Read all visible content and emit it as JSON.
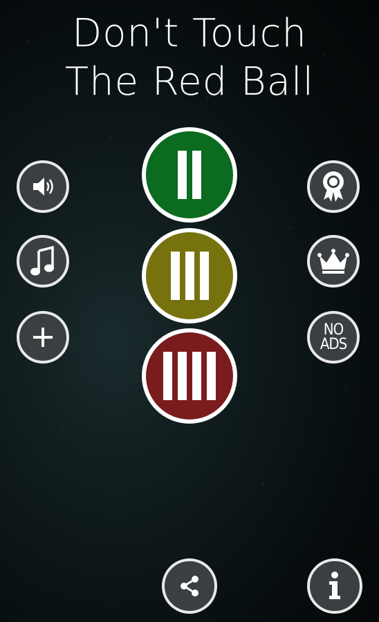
{
  "title": {
    "line1": "Don't Touch",
    "line2": "The Red Ball"
  },
  "left_buttons": [
    {
      "icon": "speaker-icon"
    },
    {
      "icon": "music-note-icon"
    },
    {
      "icon": "plus-icon"
    }
  ],
  "right_buttons": [
    {
      "icon": "award-ribbon-icon"
    },
    {
      "icon": "crown-icon"
    },
    {
      "icon": "no-ads-icon",
      "line1": "NO",
      "line2": "ADS"
    }
  ],
  "modes": [
    {
      "name": "two",
      "bars": 2,
      "color": "#0b6b1f"
    },
    {
      "name": "three",
      "bars": 3,
      "color": "#76720e"
    },
    {
      "name": "four",
      "bars": 4,
      "color": "#7a1c1e"
    }
  ],
  "bottom_buttons": [
    {
      "icon": "share-icon"
    },
    {
      "icon": "info-icon"
    }
  ]
}
